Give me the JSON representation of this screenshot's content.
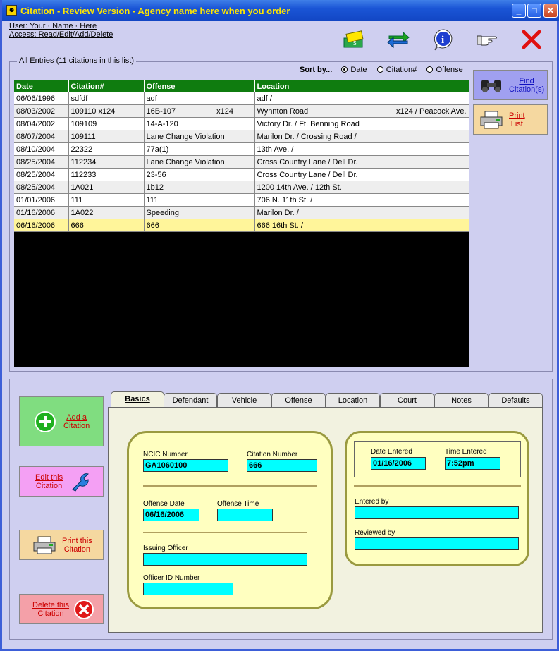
{
  "window": {
    "title": "Citation - Review Version - Agency name here when you order",
    "minimize": "_",
    "maximize": "□",
    "close": "✕"
  },
  "user": {
    "line1": "User: Your · Name · Here",
    "line2": "Access: Read/Edit/Add/Delete"
  },
  "toolbar": {
    "icons": [
      "money-icon",
      "swap-arrows-icon",
      "info-icon",
      "pointing-hand-icon",
      "exit-icon"
    ]
  },
  "entries": {
    "group_label": "All Entries (11 citations in this list)",
    "sort_label": "Sort by...",
    "sort_options": [
      "Date",
      "Citation#",
      "Offense"
    ],
    "sort_selected": "Date",
    "columns": [
      "Date",
      "Citation#",
      "Offense",
      "Location"
    ],
    "rows": [
      {
        "date": "06/06/1996",
        "citation": "sdfdf",
        "offense": "adf",
        "offense_extra": "",
        "location": "adf /",
        "location_extra": ""
      },
      {
        "date": "08/03/2002",
        "citation": "109110  x124",
        "offense": "16B-107",
        "offense_extra": "x124",
        "location": "Wynnton Road",
        "location_extra": "x124 / Peacock Ave."
      },
      {
        "date": "08/04/2002",
        "citation": "109109",
        "offense": "14-A-120",
        "offense_extra": "",
        "location": "Victory Dr. / Ft. Benning Road",
        "location_extra": ""
      },
      {
        "date": "08/07/2004",
        "citation": "109111",
        "offense": "Lane Change Violation",
        "offense_extra": "",
        "location": "Marilon Dr. /  Crossing Road /",
        "location_extra": ""
      },
      {
        "date": "08/10/2004",
        "citation": "22322",
        "offense": "77a(1)",
        "offense_extra": "",
        "location": "13th Ave. /",
        "location_extra": ""
      },
      {
        "date": "08/25/2004",
        "citation": "112234",
        "offense": "Lane Change Violation",
        "offense_extra": "",
        "location": "Cross Country Lane / Dell Dr.",
        "location_extra": ""
      },
      {
        "date": "08/25/2004",
        "citation": "112233",
        "offense": "23-56",
        "offense_extra": "",
        "location": "Cross Country Lane / Dell Dr.",
        "location_extra": ""
      },
      {
        "date": "08/25/2004",
        "citation": "1A021",
        "offense": "1b12",
        "offense_extra": "",
        "location": "1200 14th Ave. / 12th St.",
        "location_extra": ""
      },
      {
        "date": "01/01/2006",
        "citation": "111",
        "offense": "111",
        "offense_extra": "",
        "location": "706 N. 11th St. /",
        "location_extra": ""
      },
      {
        "date": "01/16/2006",
        "citation": "1A022",
        "offense": "Speeding",
        "offense_extra": "",
        "location": "Marilon Dr. /",
        "location_extra": ""
      },
      {
        "date": "06/16/2006",
        "citation": "666",
        "offense": "666",
        "offense_extra": "",
        "location": "666 16th St. /",
        "location_extra": ""
      }
    ],
    "selected_index": 10
  },
  "side_buttons": {
    "find": {
      "line1": "Find",
      "line2": "Citation(s)"
    },
    "print_list": {
      "line1": "Print",
      "line2": "List"
    }
  },
  "actions": {
    "add": {
      "line1": "Add a",
      "line2": "Citation"
    },
    "edit": {
      "line1": "Edit this",
      "line2": "Citation"
    },
    "print": {
      "line1": "Print this",
      "line2": "Citation"
    },
    "delete": {
      "line1": "Delete this",
      "line2": "Citation"
    }
  },
  "tabs": [
    "Basics",
    "Defendant",
    "Vehicle",
    "Offense",
    "Location",
    "Court",
    "Notes",
    "Defaults"
  ],
  "active_tab": "Basics",
  "basics": {
    "ncic_label": "NCIC Number",
    "ncic_value": "GA1060100",
    "citation_label": "Citation Number",
    "citation_value": "666",
    "offense_date_label": "Offense Date",
    "offense_date_value": "06/16/2006",
    "offense_time_label": "Offense Time",
    "offense_time_value": "",
    "issuing_officer_label": "Issuing Officer",
    "issuing_officer_value": "",
    "officer_id_label": "Officer ID Number",
    "officer_id_value": "",
    "date_entered_label": "Date Entered",
    "date_entered_value": "01/16/2006",
    "time_entered_label": "Time Entered",
    "time_entered_value": "7:52pm",
    "entered_by_label": "Entered by",
    "entered_by_value": "",
    "reviewed_by_label": "Reviewed by",
    "reviewed_by_value": ""
  },
  "colors": {
    "header_green": "#0f7c0f",
    "field_cyan": "#00ffff",
    "card_yellow": "#ffffc0",
    "selected_row": "#fff59a"
  }
}
